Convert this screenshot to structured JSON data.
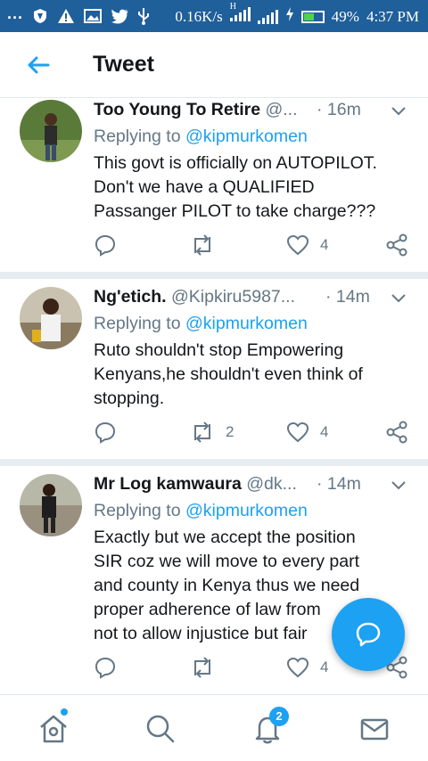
{
  "status_bar": {
    "dots": "···",
    "speed": "0.16K/s",
    "network_type": "H",
    "battery": "49%",
    "time": "4:37 PM"
  },
  "header": {
    "title": "Tweet"
  },
  "tweets": [
    {
      "name": "Too Young To Retire",
      "handle": "@...",
      "time": "· 16m",
      "replying_prefix": "Replying to ",
      "replying_to": "@kipmurkomen",
      "text_lines": [
        "This govt is officially on AUTOPILOT.",
        "Don't we have a QUALIFIED",
        "Passanger PILOT to take charge???"
      ],
      "retweets": "",
      "likes": "4"
    },
    {
      "name": "Ng'etich.",
      "handle": "@Kipkiru5987...",
      "time": "· 14m",
      "replying_prefix": "Replying to ",
      "replying_to": "@kipmurkomen",
      "text_lines": [
        "Ruto shouldn't stop Empowering",
        "Kenyans,he shouldn't even think of",
        "stopping."
      ],
      "retweets": "2",
      "likes": "4"
    },
    {
      "name": "Mr Log kamwaura",
      "handle": "@dk...",
      "time": "· 14m",
      "replying_prefix": "Replying to ",
      "replying_to": "@kipmurkomen",
      "text_lines": [
        "Exactly but we accept the position",
        "SIR coz we will move to every part",
        "and county in Kenya thus we need",
        "proper adherence of law from",
        "not to allow injustice but fair"
      ],
      "retweets": "",
      "likes": "4"
    }
  ],
  "bottom_nav": {
    "notifications_badge": "2"
  },
  "colors": {
    "accent": "#1da1f2",
    "status_bar": "#1f5f9a",
    "muted": "#657786"
  }
}
